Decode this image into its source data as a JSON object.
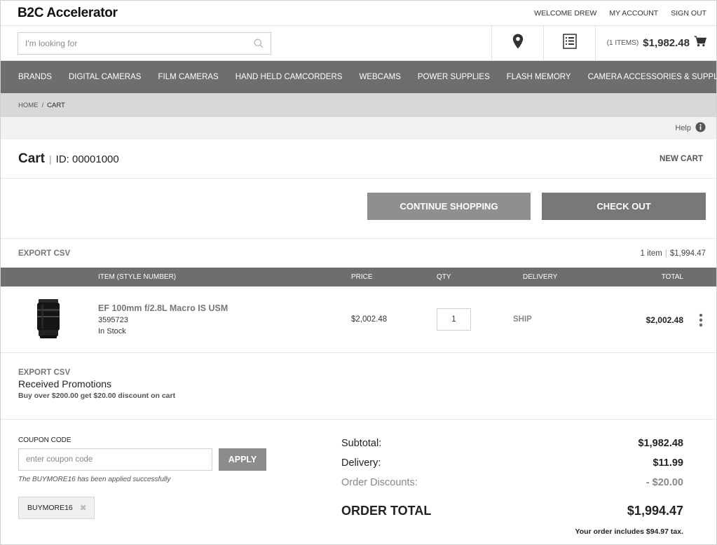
{
  "header": {
    "brand": "B2C Accelerator",
    "welcome": "WELCOME DREW",
    "my_account": "MY ACCOUNT",
    "sign_out": "SIGN OUT"
  },
  "search": {
    "placeholder": "I'm looking for"
  },
  "minicart": {
    "items": "(1 ITEMS)",
    "total": "$1,982.48"
  },
  "nav": {
    "items": [
      "BRANDS",
      "DIGITAL CAMERAS",
      "FILM CAMERAS",
      "HAND HELD CAMCORDERS",
      "WEBCAMS",
      "POWER SUPPLIES",
      "FLASH MEMORY",
      "CAMERA ACCESSORIES & SUPPLIES"
    ]
  },
  "breadcrumb": {
    "home": "HOME",
    "separator": "/",
    "current": "CART"
  },
  "help": {
    "label": "Help"
  },
  "cart": {
    "title": "Cart",
    "id_label": "ID: 00001000",
    "new_cart": "NEW CART",
    "continue_shopping": "CONTINUE SHOPPING",
    "check_out": "CHECK OUT",
    "export_csv": "EXPORT CSV",
    "item_count": "1 item",
    "summary_total": "$1,994.47"
  },
  "table": {
    "columns": {
      "item": "ITEM (STYLE NUMBER)",
      "price": "PRICE",
      "qty": "QTY",
      "delivery": "DELIVERY",
      "total": "TOTAL"
    },
    "rows": [
      {
        "name": "EF 100mm f/2.8L Macro IS USM",
        "number": "3595723",
        "stock": "In Stock",
        "price": "$2,002.48",
        "qty": "1",
        "delivery": "SHIP",
        "total": "$2,002.48"
      }
    ]
  },
  "promotions": {
    "export_csv": "EXPORT CSV",
    "title": "Received Promotions",
    "description": "Buy over $200.00 get $20.00 discount on cart"
  },
  "coupon": {
    "label": "COUPON CODE",
    "placeholder": "enter coupon code",
    "apply": "APPLY",
    "message": "The BUYMORE16 has been applied successfully",
    "applied_code": "BUYMORE16",
    "remove_glyph": "✖"
  },
  "totals": {
    "subtotal_label": "Subtotal:",
    "subtotal": "$1,982.48",
    "delivery_label": "Delivery:",
    "delivery": "$11.99",
    "discounts_label": "Order Discounts:",
    "discounts": "- $20.00",
    "order_total_label": "ORDER TOTAL",
    "order_total": "$1,994.47",
    "tax_note": "Your order includes $94.97 tax."
  },
  "colors": {
    "nav_bg": "#6e6e6e",
    "breadcrumb_bg": "#d8d8d8",
    "button_gray": "#8c8c8c",
    "checkout_gray": "#787878"
  },
  "icons": {
    "search": "search-icon",
    "location": "location-pin-icon",
    "list": "order-list-icon",
    "cart": "cart-icon",
    "help": "info-icon",
    "kebab": "more-vertical-icon"
  }
}
